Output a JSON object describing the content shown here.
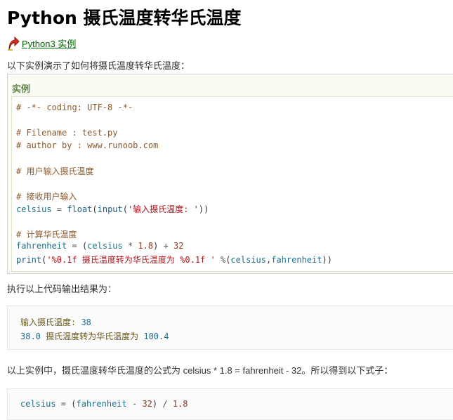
{
  "page": {
    "title": "Python 摄氏温度转华氏温度",
    "back_link": {
      "icon": "red-up-arrow-icon",
      "label": "Python3 实例"
    },
    "intro": "以下实例演示了如何将摄氏温度转华氏温度：",
    "example_title": "实例",
    "code": {
      "l1": "# -*- coding: UTF-8 -*-",
      "l2": "# Filename : test.py",
      "l3": "# author by : www.runoob.com",
      "l4": "# 用户输入摄氏温度",
      "l5": "# 接收用户输入",
      "l6": {
        "var": "celsius",
        "op": " = ",
        "fn1": "float",
        "p1": "(",
        "fn2": "input",
        "p2": "(",
        "str": "'输入摄氏温度: '",
        "p3": "))"
      },
      "l7": "# 计算华氏温度",
      "l8": {
        "var": "fahrenheit",
        "op": " = ",
        "p1": "(",
        "v2": "celsius",
        "op2": " * ",
        "n1": "1.8",
        "p2": ")",
        "op3": " + ",
        "n2": "32"
      },
      "l9": {
        "fn": "print",
        "p1": "(",
        "str": "'%0.1f 摄氏温度转为华氏温度为 %0.1f '",
        "op": " %",
        "p2": "(",
        "v1": "celsius",
        "comma": ",",
        "v2": "fahrenheit",
        "p3": "))"
      }
    },
    "output_intro": "执行以上代码输出结果为：",
    "output": {
      "line1_text": "输入摄氏温度: ",
      "line1_num": "38",
      "line2_num1": "38.0",
      "line2_text": " 摄氏温度转为华氏温度为 ",
      "line2_num2": "100.4"
    },
    "formula_intro": "以上实例中，摄氏温度转华氏温度的公式为 celsius * 1.8 = fahrenheit - 32。所以得到以下式子：",
    "formula": {
      "var": "celsius",
      "op": " = ",
      "p1": "(",
      "v2": "fahrenheit",
      "op2": " - ",
      "n": "32",
      "p2": ")",
      "op3": " / ",
      "n2": "1.8"
    }
  }
}
